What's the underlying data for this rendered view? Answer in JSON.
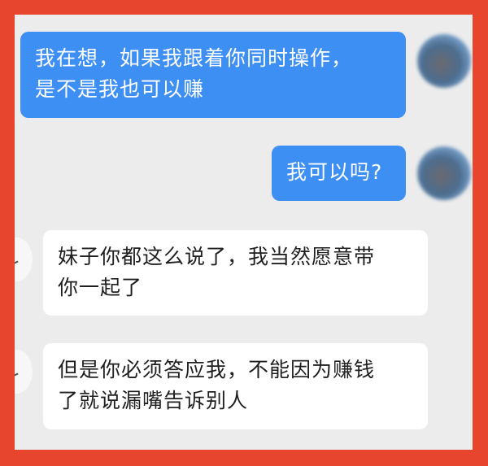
{
  "messages": [
    {
      "side": "out",
      "text_line1": "我在想，如果我跟着你同时操作，",
      "text_line2": "是不是我也可以赚"
    },
    {
      "side": "out",
      "text": "我可以吗?"
    },
    {
      "side": "in",
      "text_line1": "妹子你都这么说了，我当然愿意带",
      "text_line2": "你一起了"
    },
    {
      "side": "in",
      "text_line1": "但是你必须答应我，不能因为赚钱",
      "text_line2": "了就说漏嘴告诉别人"
    }
  ],
  "colors": {
    "outgoing_bubble": "#3d8ff3",
    "incoming_bubble": "#ffffff",
    "border": "#e8452f",
    "background": "#ececec"
  }
}
